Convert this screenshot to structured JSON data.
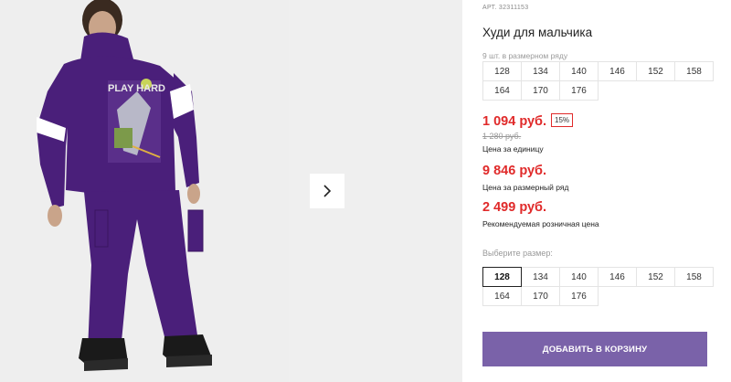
{
  "gallery": {
    "next_icon": "chevron-right-icon",
    "photo_alt": "Худи для мальчика"
  },
  "product": {
    "art": "АРТ. 32311153",
    "title": "Худи для мальчика",
    "pack_note": "9 шт. в размерном ряду",
    "pack_sizes": [
      "128",
      "134",
      "140",
      "146",
      "152",
      "158",
      "164",
      "170",
      "176"
    ],
    "price": "1 094 руб.",
    "discount": "15%",
    "old_price": "1 280 руб.",
    "unit_label": "Цена за единицу",
    "row_price": "9 846 руб.",
    "row_label": "Цена за размерный ряд",
    "retail_price": "2 499 руб.",
    "retail_label": "Рекомендуемая розничная цена",
    "choose_label": "Выберите размер:",
    "choose_sizes": [
      "128",
      "134",
      "140",
      "146",
      "152",
      "158",
      "164",
      "170",
      "176"
    ],
    "selected_size": "128",
    "cart_button": "ДОБАВИТЬ В КОРЗИНУ"
  },
  "colors": {
    "accent": "#7a62a9",
    "price": "#e02a2a",
    "hoodie": "#4a1f7a"
  }
}
